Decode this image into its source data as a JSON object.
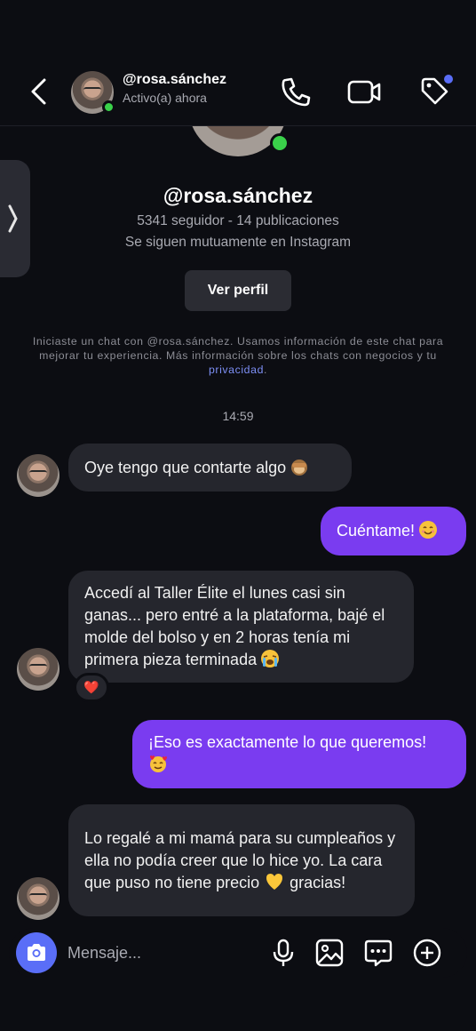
{
  "header": {
    "name": "@rosa.sánchez",
    "status": "Activo(a) ahora"
  },
  "profile": {
    "name": "@rosa.sánchez",
    "stats": "5341 seguidor - 14 publicaciones",
    "mutual": "Se siguen mutuamente en Instagram",
    "view_profile_label": "Ver perfil"
  },
  "disclaimer": {
    "text": "Iniciaste un chat con @rosa.sánchez. Usamos información de este chat para mejorar tu experiencia. Más información sobre los chats con negocios y tu",
    "link": "privacidad",
    "suffix": "."
  },
  "timestamp": "14:59",
  "messages": [
    {
      "direction": "in",
      "text": "Oye tengo que contarte algo",
      "emoji": "see-no-evil-monkey"
    },
    {
      "direction": "out",
      "text": "Cuéntame!",
      "emoji": "smiling-face"
    },
    {
      "direction": "in",
      "text": "Accedí al Taller Élite el lunes casi sin ganas... pero entré a la plataforma, bajé el molde del bolso y en 2 horas tenía mi primera pieza terminada",
      "emoji": "loudly-crying-face",
      "reaction": "❤️"
    },
    {
      "direction": "out",
      "text": "¡Eso es exactamente lo que queremos!",
      "emoji": "smiling-face-with-hearts"
    },
    {
      "direction": "in",
      "text_before": "Lo regalé a mi mamá para su cumpleaños y ella no podía creer que lo hice yo. La cara que puso no tiene precio",
      "emoji": "yellow-heart",
      "text_after": "gracias!"
    }
  ],
  "composer": {
    "placeholder": "Mensaje..."
  },
  "colors": {
    "background": "#0c0d12",
    "incoming_bubble": "#25262d",
    "outgoing_bubble": "#7a3cf0",
    "accent": "#5a6ef7",
    "online": "#3ad14a"
  }
}
